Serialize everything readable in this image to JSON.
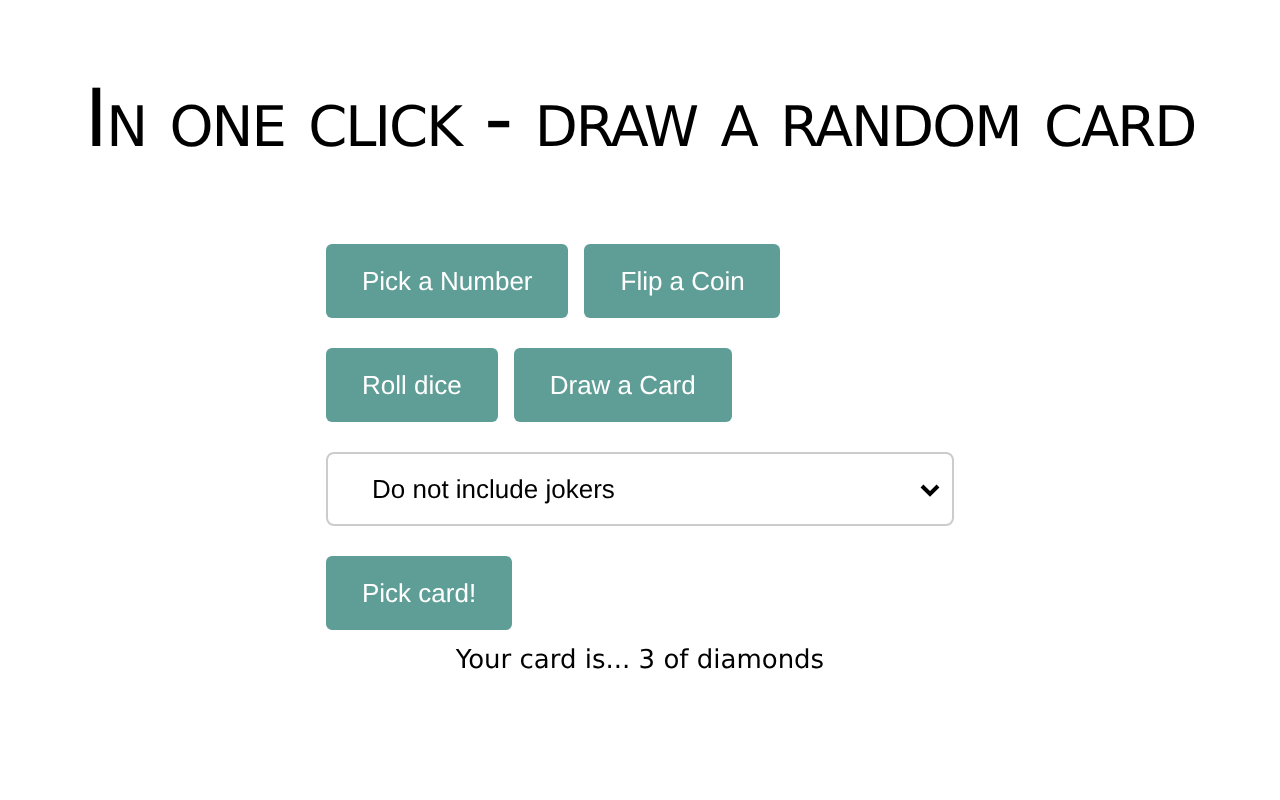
{
  "title": "In one click - draw a random card",
  "modes": [
    {
      "label": "Pick a Number"
    },
    {
      "label": "Flip a Coin"
    },
    {
      "label": "Roll dice"
    },
    {
      "label": "Draw a Card"
    }
  ],
  "joker_select": {
    "value": "Do not include jokers"
  },
  "pick_button": "Pick card!",
  "result": "Your card is... 3 of diamonds"
}
